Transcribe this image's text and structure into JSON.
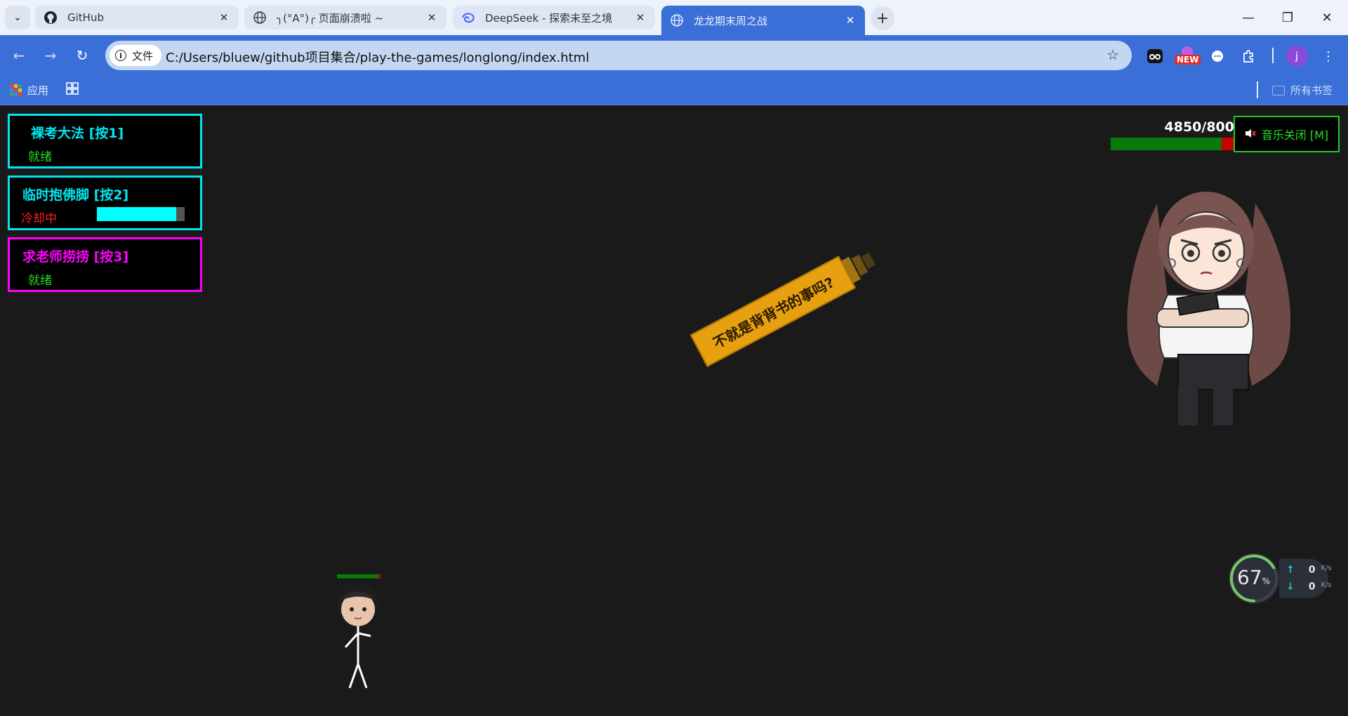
{
  "browser": {
    "tabs": [
      {
        "title": "GitHub",
        "icon": "github-icon"
      },
      {
        "title": "╮(°A°)╭ 页面崩溃啦 ~",
        "icon": "globe-icon"
      },
      {
        "title": "DeepSeek - 探索未至之境",
        "icon": "deepseek-icon"
      },
      {
        "title": "龙龙期末周之战",
        "icon": "globe-icon"
      }
    ],
    "active_tab": 3,
    "address": {
      "chip_label": "文件",
      "url": "C:/Users/bluew/github项目集合/play-the-games/longlong/index.html"
    },
    "bookmarks": {
      "apps_label": "应用",
      "all_bookmarks_label": "所有书签"
    },
    "extensions": {
      "new_badge": "NEW",
      "profile_initial": "j"
    }
  },
  "game": {
    "skills": [
      {
        "name": "裸考大法 [按1]",
        "status": "就绪",
        "state": "ready",
        "color": "#00e5ee"
      },
      {
        "name": "临时抱佛脚 [按2]",
        "status": "冷却中",
        "state": "cooldown",
        "cooldown_progress": 0.9,
        "color": "#00e5ee"
      },
      {
        "name": "求老师捞捞 [按3]",
        "status": "就绪",
        "state": "ready",
        "color": "#ff00ff"
      }
    ],
    "boss": {
      "hp_text": "4850/800",
      "hp_fraction": 0.9
    },
    "music_button": {
      "label": "音乐关闭 [M]",
      "icon": "speaker-muted-icon"
    },
    "projectile_text": "不就是背背书的事吗?",
    "player": {
      "hp_fraction": 0.95
    }
  },
  "netmon": {
    "percent": "67",
    "percent_unit": "%",
    "upload": "0",
    "download": "0",
    "unit": "K/s"
  },
  "colors": {
    "chrome_blue": "#3b6fd8",
    "ready_green": "#22dd22",
    "cooldown_red": "#ff2020",
    "cyan": "#00e5ee",
    "magenta": "#ff00ff"
  }
}
